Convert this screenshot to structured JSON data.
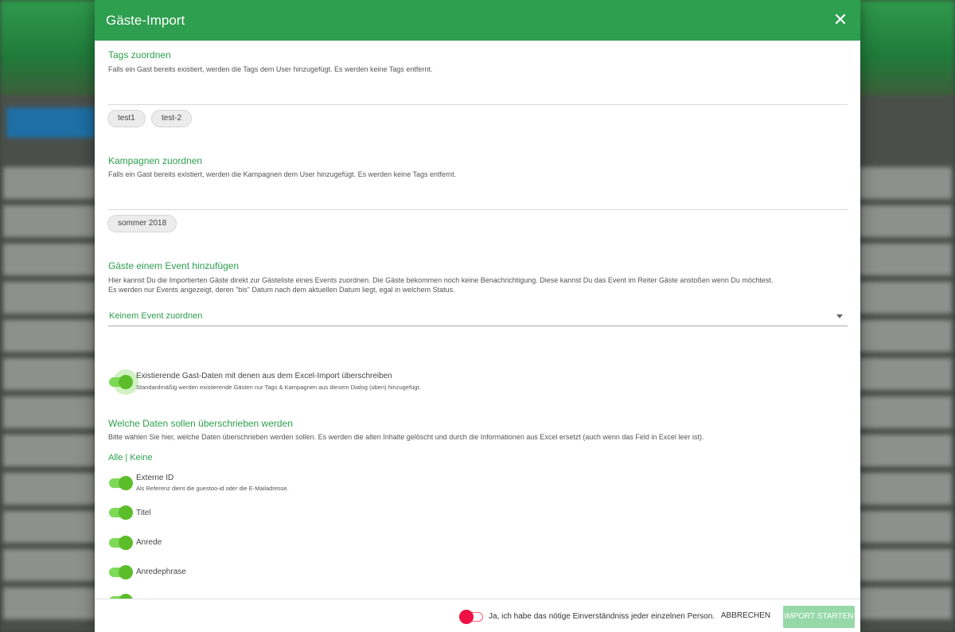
{
  "modal": {
    "title": "Gäste-Import",
    "close_icon": "close-icon"
  },
  "tags": {
    "title": "Tags zuordnen",
    "description": "Falls ein Gast bereits existiert, werden die Tags dem User hinzugefügt. Es werden keine Tags entfernt.",
    "chips": [
      "test1",
      "test-2"
    ]
  },
  "campaigns": {
    "title": "Kampagnen zuordnen",
    "description": "Falls ein Gast bereits existiert, werden die Kampagnen dem User hinzugefügt. Es werden keine Tags entfernt.",
    "chips": [
      "sommer 2018"
    ]
  },
  "event": {
    "title": "Gäste einem Event hinzufügen",
    "description_line1": "Hier kannst Du die Importierten Gäste direkt zur Gästeliste eines Events zuordnen. Die Gäste bekommen noch keine Benachrichtigung. Diese kannst Du das Event im Reiter Gäste anstoßen wenn Du möchtest.",
    "description_line2": "Es werden nur Events angezeigt, deren \"bis\" Datum nach dem aktuellen Datum liegt, egal in welchem Status.",
    "select_value": "Keinem Event zuordnen"
  },
  "overwrite": {
    "label": "Existierende Gast-Daten mit denen aus dem Excel-Import überschreiben",
    "sub": "Standardmäßig werden existierende Gästen nur Tags & Kampagnen aus diesem Dialog (oben) hinzugefügt.",
    "enabled": true
  },
  "fields": {
    "title": "Welche Daten sollen überschrieben werden",
    "description": "Bitte wählen Sie hier, welche Daten überschrieben werden sollen. Es werden die alten Inhalte gelöscht und durch die Informationen aus Excel ersetzt (auch wenn das Feld in Excel leer ist).",
    "all_none": "Alle | Keine",
    "items": [
      {
        "label": "Externe ID",
        "sub": "Als Referenz dient die guestoo-id oder die E-Mailadresse.",
        "enabled": true
      },
      {
        "label": "Titel",
        "enabled": true
      },
      {
        "label": "Anrede",
        "enabled": true
      },
      {
        "label": "Anredephrase",
        "enabled": true
      }
    ]
  },
  "footer": {
    "consent_label": "Ja, ich habe das nötige Einverständniss jeder einzelnen Person.",
    "consent_enabled": false,
    "cancel_label": "ABBRECHEN",
    "import_label": "IMPORT STARTEN"
  },
  "colors": {
    "primary": "#2e9e4f",
    "toggle_on": "#5cbd2b",
    "toggle_off_knob": "#ee1144",
    "import_disabled": "#97d8a9"
  }
}
